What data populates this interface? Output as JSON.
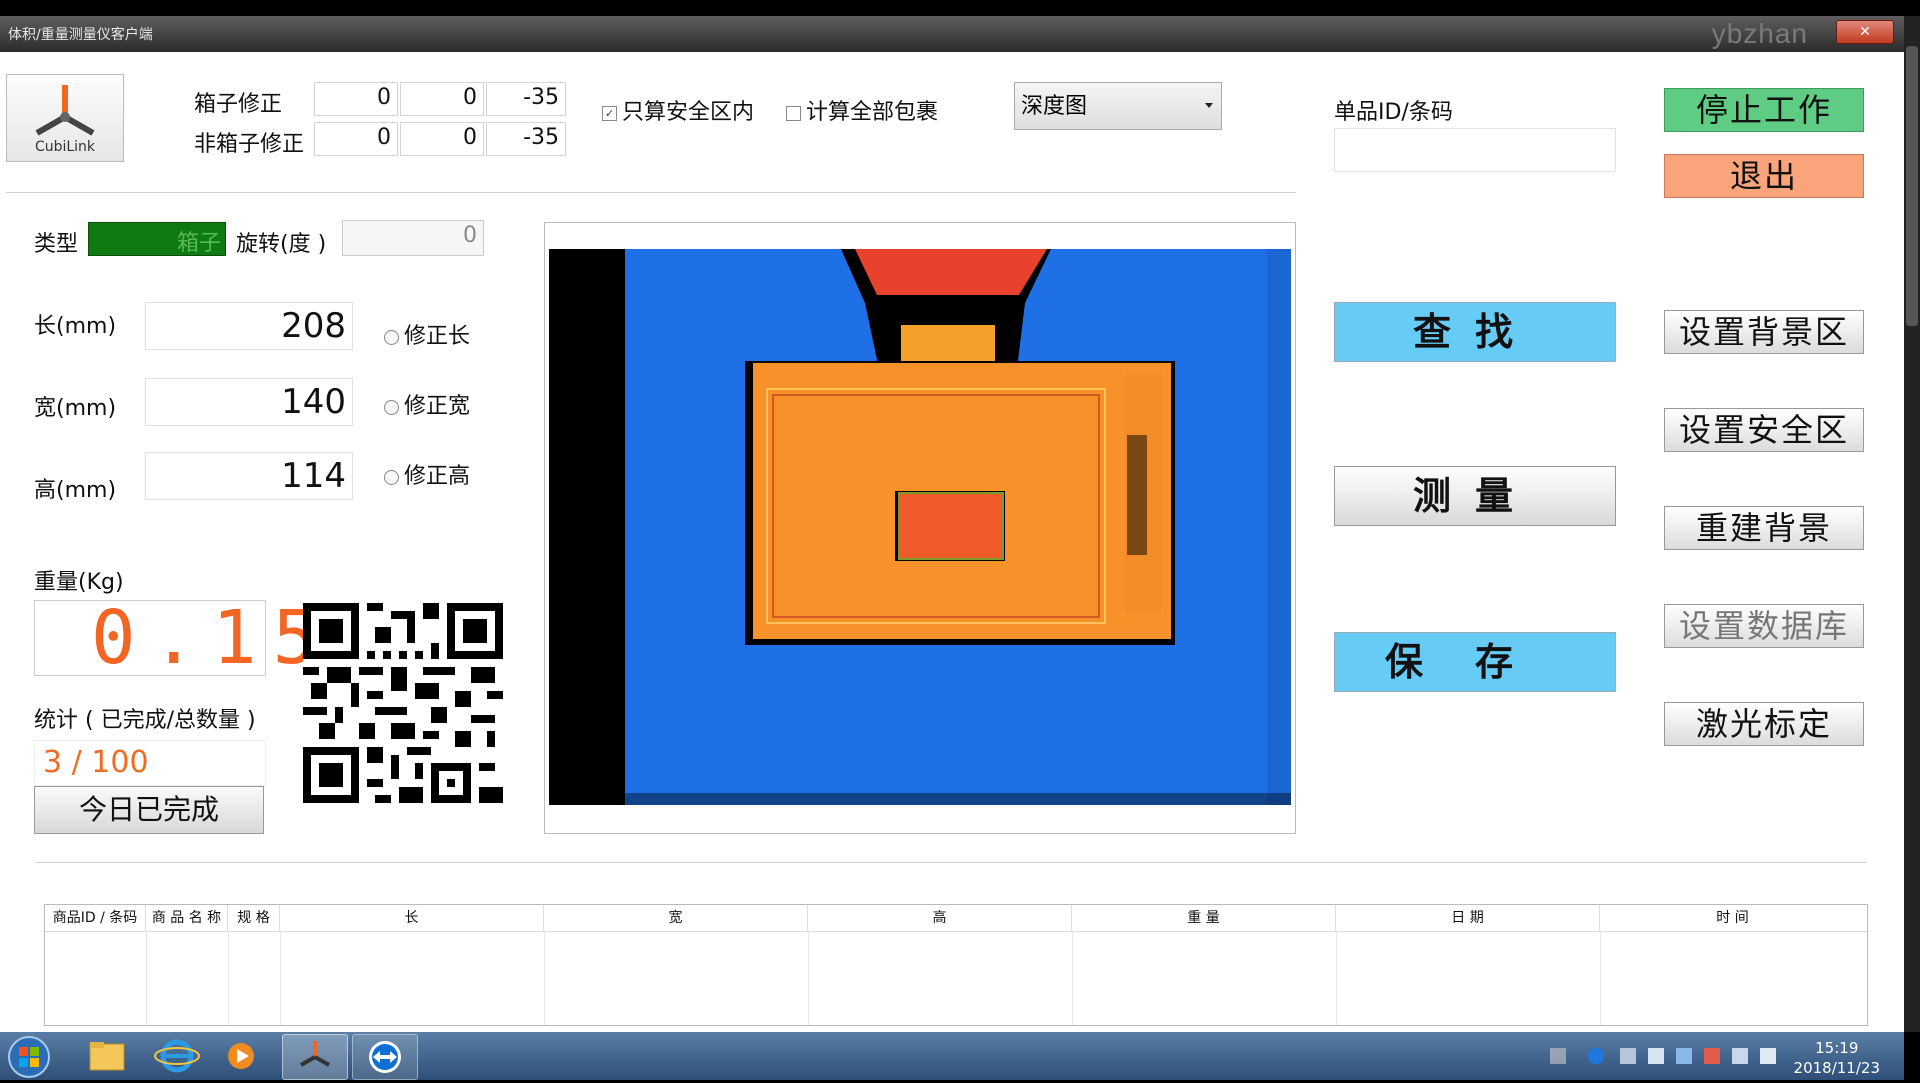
{
  "window": {
    "title": "体积/重量测量仪客户端",
    "watermark": "ybzhan",
    "close_label": "✕"
  },
  "logo": {
    "label": "CubiLink"
  },
  "correction": {
    "box_label": "箱子修正",
    "box_values": [
      "0",
      "0",
      "-35"
    ],
    "nonbox_label": "非箱子修正",
    "nonbox_values": [
      "0",
      "0",
      "-35"
    ]
  },
  "options": {
    "safe_zone_only": {
      "label": "只算安全区内",
      "checked": true
    },
    "all_packages": {
      "label": "计算全部包裹",
      "checked": false
    }
  },
  "view_select": {
    "value": "深度图"
  },
  "item_id": {
    "label": "单品ID/条码",
    "value": ""
  },
  "type_row": {
    "type_label": "类型",
    "type_value": "箱子",
    "rotation_label": "旋转(度 )",
    "rotation_value": "0"
  },
  "dimensions": {
    "length": {
      "label": "长(mm)",
      "value": "208",
      "fix_label": "修正长"
    },
    "width": {
      "label": "宽(mm)",
      "value": "140",
      "fix_label": "修正宽"
    },
    "height": {
      "label": "高(mm)",
      "value": "114",
      "fix_label": "修正高"
    }
  },
  "weight": {
    "label": "重量(Kg)",
    "value": "0.15"
  },
  "stats": {
    "label": "统计 ( 已完成/总数量 )",
    "completed": 3,
    "total": 100,
    "value_text": "3 / 100",
    "today_button": "今日已完成"
  },
  "actions": {
    "stop": "停止工作",
    "exit": "退出",
    "find": "查找",
    "measure": "测量",
    "save": "保存",
    "set_background": "设置背景区",
    "set_safe_zone": "设置安全区",
    "rebuild_background": "重建背景",
    "set_database": "设置数据库",
    "laser_calibrate": "激光标定"
  },
  "table": {
    "headers": [
      "商品ID / 条码",
      "商 品 名 称",
      "规  格",
      "长",
      "宽",
      "高",
      "重 量",
      "日 期",
      "时 间"
    ],
    "rows": []
  },
  "clock": {
    "time": "15:19",
    "date": "2018/11/23"
  },
  "colors": {
    "stop_button": "#5fcc84",
    "exit_button": "#f9a47a",
    "action_button": "#66ccf6",
    "weight_digits": "#f26522",
    "type_badge": "#0f7a10",
    "depth_background": "#1f6fe6",
    "depth_object": "#f7922a",
    "depth_top": "#f05a2a"
  },
  "icons": {
    "logo": "cubilink-logo",
    "dropdown": "chevron-down-icon",
    "start": "windows-start-icon",
    "explorer": "folder-icon",
    "browser": "ie-icon",
    "media": "media-player-icon",
    "teamviewer": "teamviewer-icon"
  }
}
